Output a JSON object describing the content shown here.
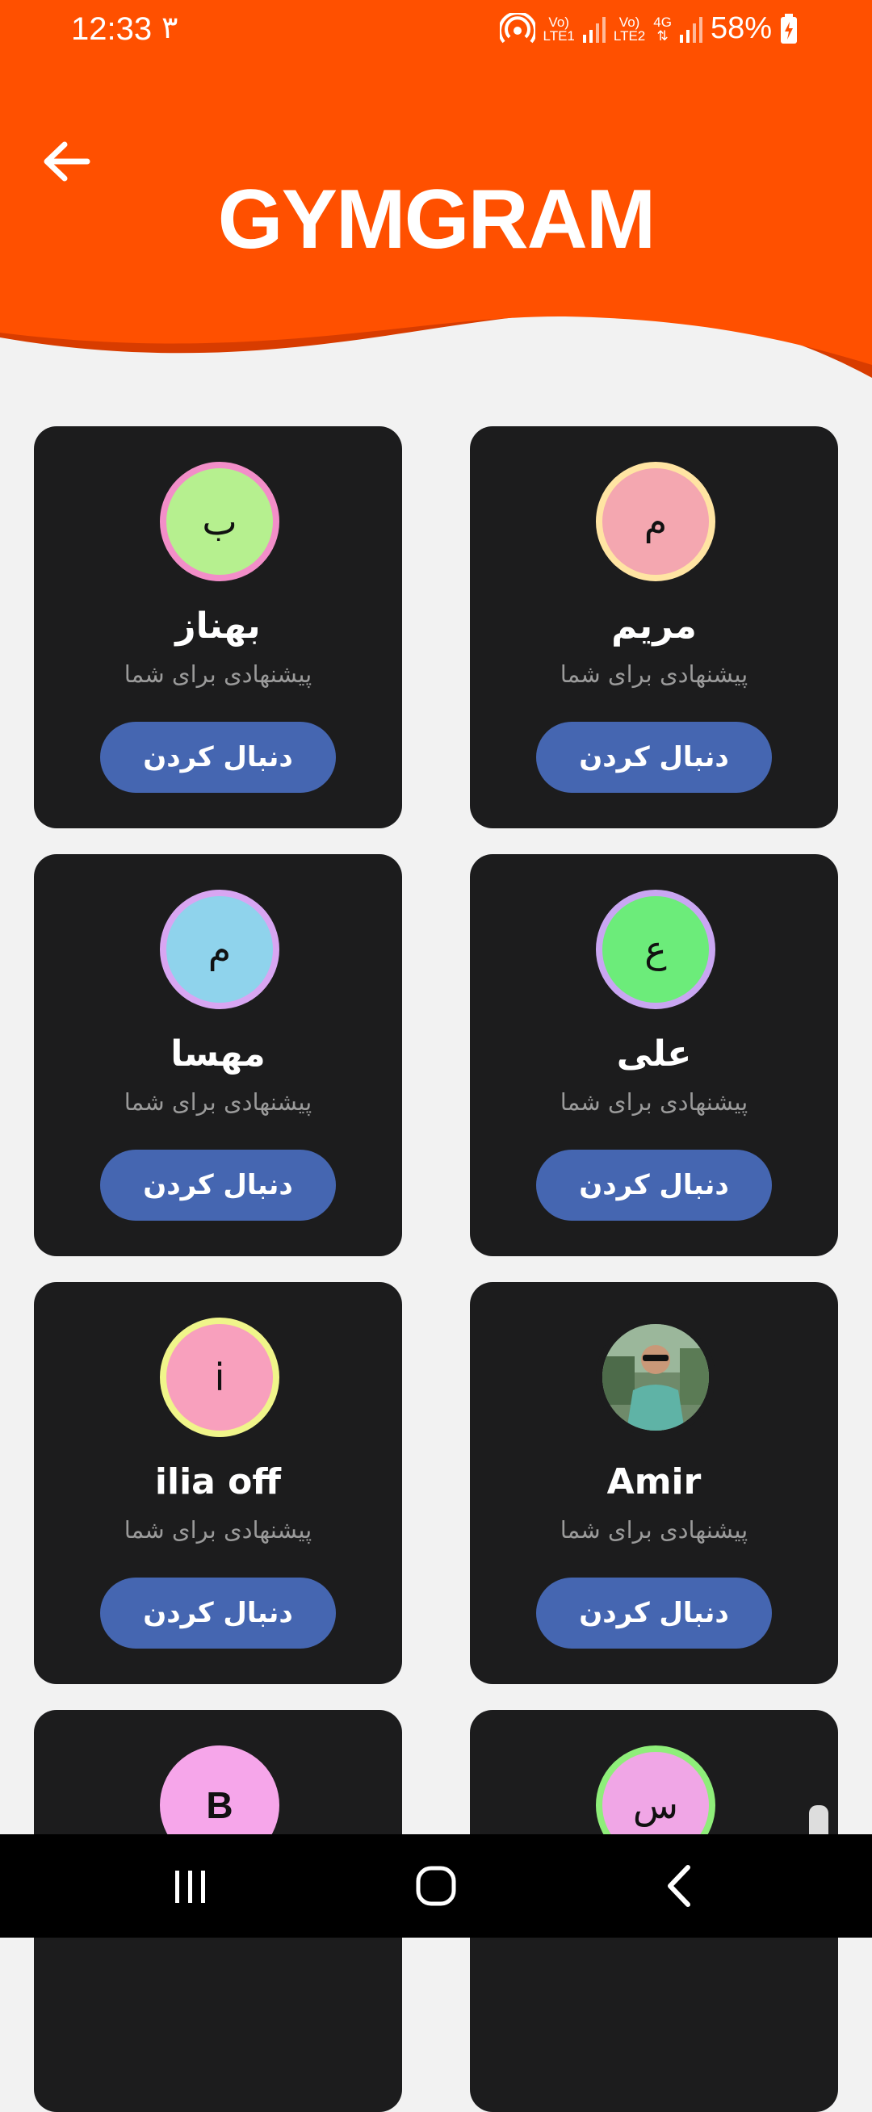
{
  "status": {
    "time": "12:33",
    "extra": "۳",
    "sim1_top": "Vo)",
    "sim1_bottom": "LTE1",
    "sim2_top": "Vo)",
    "sim2_bottom": "LTE2",
    "network": "4G",
    "battery": "58%"
  },
  "header": {
    "logo": "GYMGRAM",
    "accent_color": "#ff5000",
    "wave_color": "#d83c00"
  },
  "cards": [
    {
      "name": "مریم",
      "initial": "م",
      "subtitle": "پیشنهادی برای شما",
      "button": "دنبال کردن",
      "fill": "#f4a7b0",
      "ring": "#ffe4a3"
    },
    {
      "name": "بهناز",
      "initial": "ب",
      "subtitle": "پیشنهادی برای شما",
      "button": "دنبال کردن",
      "fill": "#b6f08f",
      "ring": "#f28ec8"
    },
    {
      "name": "علی",
      "initial": "ع",
      "subtitle": "پیشنهادی برای شما",
      "button": "دنبال کردن",
      "fill": "#6cec7a",
      "ring": "#c9a6f2"
    },
    {
      "name": "مهسا",
      "initial": "م",
      "subtitle": "پیشنهادی برای شما",
      "button": "دنبال کردن",
      "fill": "#8fd3ec",
      "ring": "#d8a6f2"
    },
    {
      "name": "Amir",
      "initial": "",
      "subtitle": "پیشنهادی برای شما",
      "button": "دنبال کردن",
      "fill": "#6a8a77",
      "ring": "#1c1c1d",
      "photo": true
    },
    {
      "name": "ilia off",
      "initial": "i",
      "subtitle": "پیشنهادی برای شما",
      "button": "دنبال کردن",
      "fill": "#f8a0bd",
      "ring": "#f0f58a"
    },
    {
      "name": "",
      "initial": "س",
      "subtitle": "",
      "button": "",
      "fill": "#f0a6e6",
      "ring": "#8fee7a"
    },
    {
      "name": "",
      "initial": "B",
      "subtitle": "",
      "button": "",
      "fill": "#f6a6ea",
      "ring": "#f6a6ea"
    }
  ]
}
